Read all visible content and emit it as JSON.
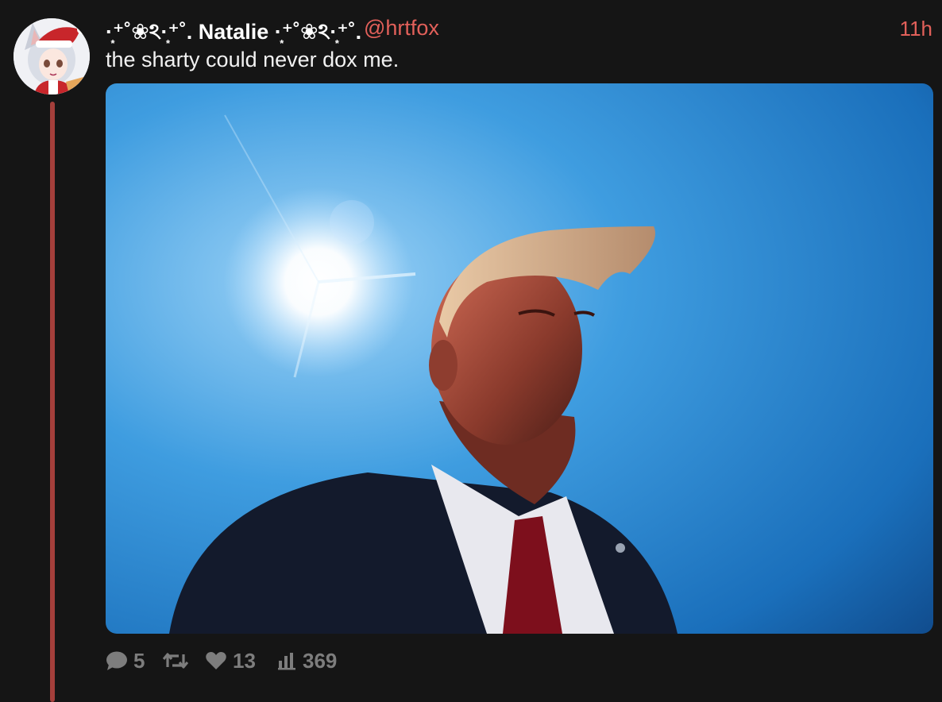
{
  "post": {
    "display_name": "·͙⁺˚❀ঽ·͙⁺˚. Natalie ·͙⁺˚❀ঽ·͙⁺˚.",
    "handle": "@hrtfox",
    "timestamp": "11h",
    "text": "the sharty could never dox me."
  },
  "actions": {
    "replies": "5",
    "likes": "13",
    "views": "369"
  },
  "colors": {
    "background": "#151515",
    "accent": "#e2605a",
    "thread_line": "#a43f3b",
    "muted": "#7d7d7d"
  },
  "icons": [
    "avatar",
    "reply-icon",
    "repost-icon",
    "like-icon",
    "views-icon"
  ]
}
